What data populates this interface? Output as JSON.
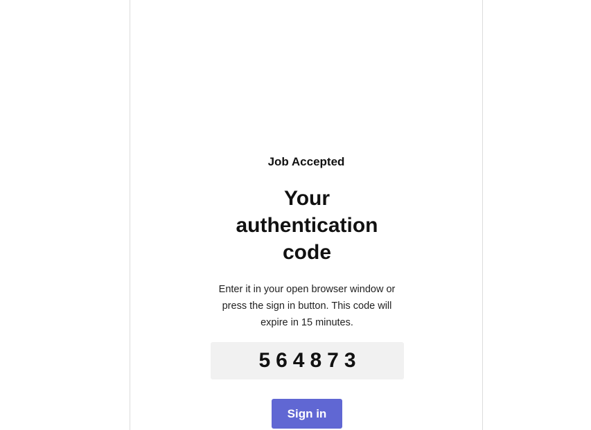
{
  "email": {
    "eyebrow": "Job Accepted",
    "headline": "Your authentication code",
    "description": "Enter it in your open browser window or press the sign in button. This code will expire in 15 minutes.",
    "code": "564873",
    "signin_label": "Sign in",
    "accent_color": "#6067d3",
    "code_background": "#f1f1f1"
  }
}
